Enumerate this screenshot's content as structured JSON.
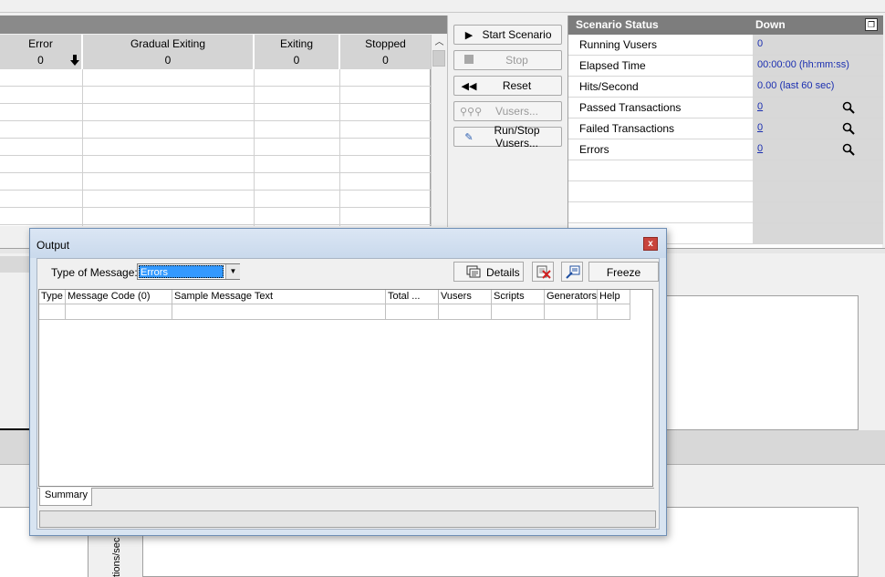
{
  "vuser_grid": {
    "columns": [
      {
        "label": "Error",
        "value": "0"
      },
      {
        "label": "Gradual Exiting",
        "value": "0"
      },
      {
        "label": "Exiting",
        "value": "0"
      },
      {
        "label": "Stopped",
        "value": "0"
      }
    ]
  },
  "controls": {
    "start_scenario": "Start Scenario",
    "stop": "Stop",
    "reset": "Reset",
    "vusers": "Vusers...",
    "run_stop_vusers": "Run/Stop Vusers..."
  },
  "scenario_status": {
    "title": "Scenario Status",
    "state": "Down",
    "rows": [
      {
        "label": "Running Vusers",
        "value": "0"
      },
      {
        "label": "Elapsed Time",
        "value": "00:00:00 (hh:mm:ss)"
      },
      {
        "label": "Hits/Second",
        "value": "0.00 (last 60 sec)"
      },
      {
        "label": "Passed Transactions",
        "value": "0"
      },
      {
        "label": "Failed Transactions",
        "value": "0"
      },
      {
        "label": "Errors",
        "value": "0"
      }
    ]
  },
  "chart_axis_label": "tions/sec",
  "output_dialog": {
    "title": "Output",
    "close_label": "x",
    "type_of_message_label": "Type of Message:",
    "type_of_message_value": "Errors",
    "details_label": "Details",
    "freeze_label": "Freeze",
    "table_headers": [
      "Type",
      "Message Code (0)",
      "Sample Message Text",
      "Total ...",
      "Vusers",
      "Scripts",
      "Generators",
      "Help"
    ],
    "tab_summary": "Summary"
  },
  "colors": {
    "status_link": "#1a2eb0",
    "header_bar": "#7d7d7d",
    "dialog_frame": "#d8e4f1"
  }
}
